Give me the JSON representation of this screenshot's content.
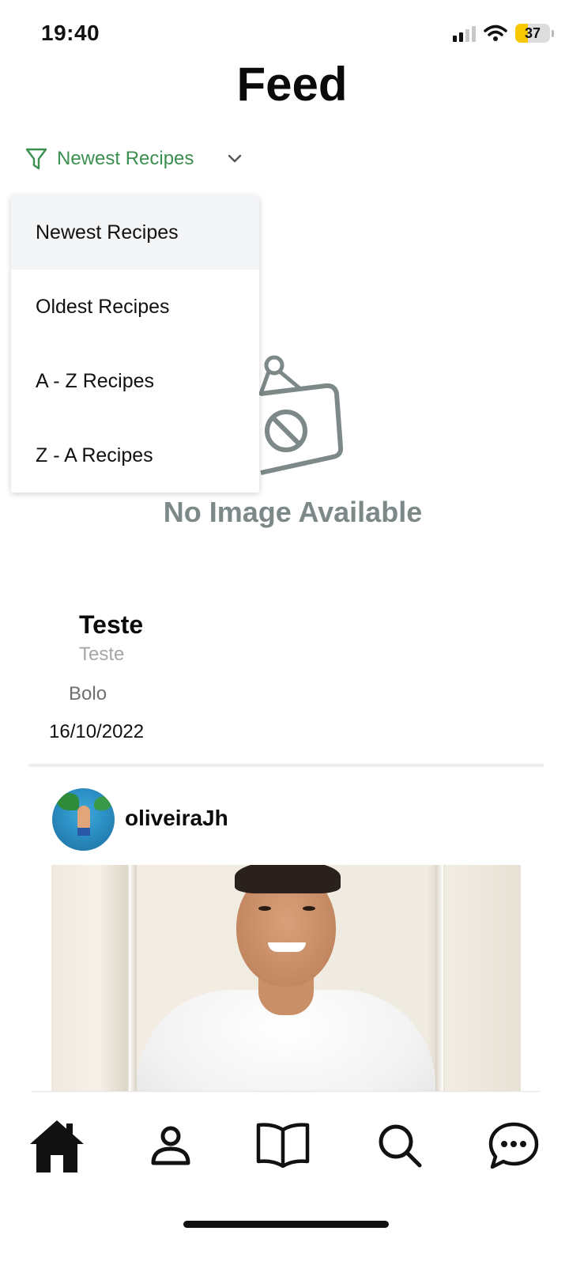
{
  "status_bar": {
    "time": "19:40",
    "battery": "37"
  },
  "header": {
    "title": "Feed"
  },
  "filter": {
    "selected": "Newest Recipes",
    "options": [
      "Newest Recipes",
      "Oldest Recipes",
      "A - Z Recipes",
      "Z - A Recipes"
    ],
    "accent_color": "#3b8f4f"
  },
  "placeholder": {
    "text": "No Image Available"
  },
  "post": {
    "title": "Teste",
    "subtitle": "Teste",
    "category": "Bolo",
    "date": "16/10/2022"
  },
  "next_post": {
    "username": "oliveiraJh"
  },
  "bottom_nav": {
    "icons": [
      "home-icon",
      "profile-icon",
      "book-icon",
      "search-icon",
      "chat-icon"
    ]
  }
}
